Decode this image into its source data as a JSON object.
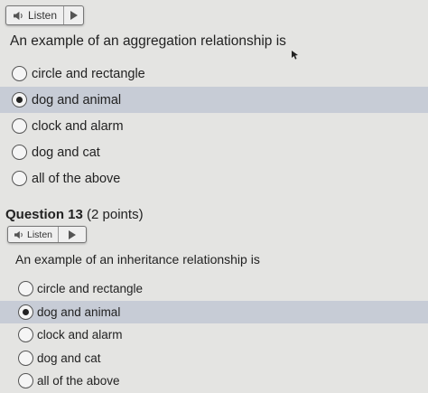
{
  "q1": {
    "listen_label": "Listen",
    "prompt": "An example of an aggregation relationship is",
    "options": [
      "circle and rectangle",
      "dog and animal",
      "clock and alarm",
      "dog and cat",
      "all of the above"
    ],
    "selected_index": 1
  },
  "q2": {
    "title": "Question 13",
    "points": "(2 points)",
    "listen_label": "Listen",
    "prompt": "An example of an inheritance relationship is",
    "options": [
      "circle and rectangle",
      "dog and animal",
      "clock and alarm",
      "dog and cat",
      "all of the above"
    ],
    "selected_index": 1
  },
  "colors": {
    "selected_row": "#c7ccd6",
    "page_bg": "#e4e4e2"
  }
}
